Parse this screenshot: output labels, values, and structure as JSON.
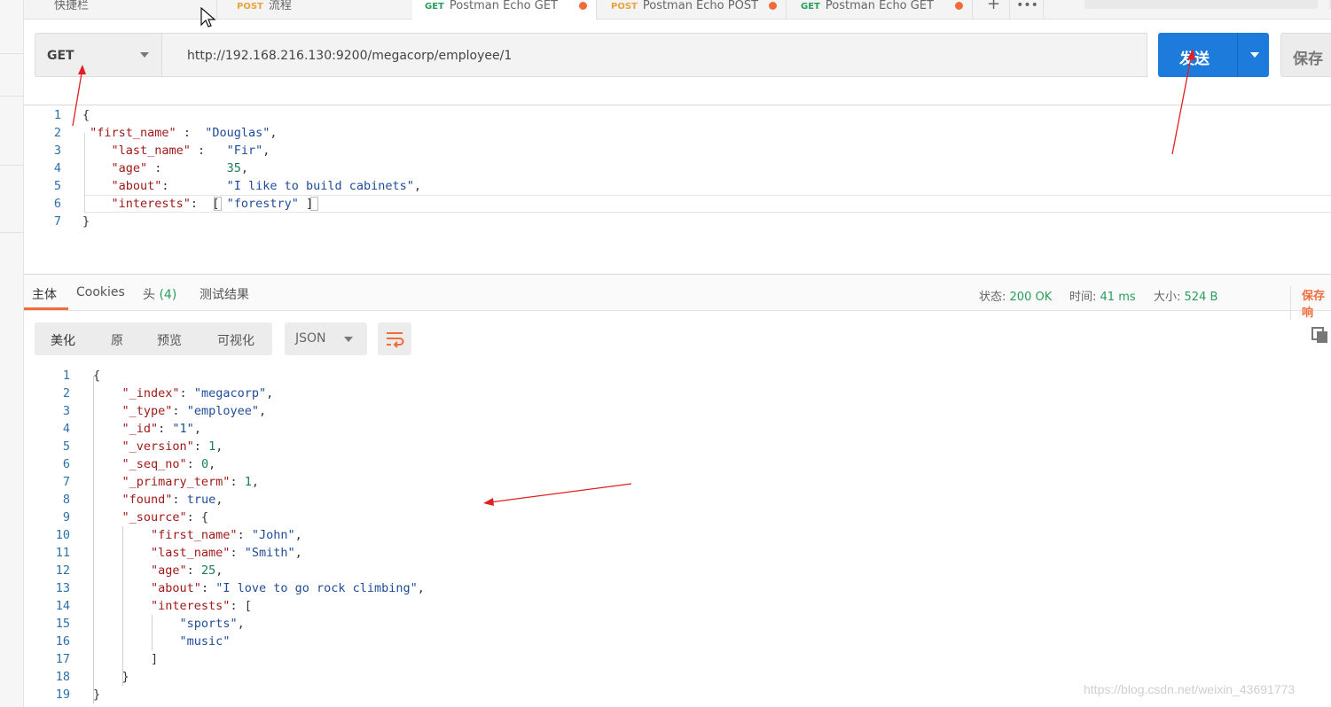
{
  "tabs": [
    {
      "label": "快捷栏",
      "method": "",
      "active": false,
      "dot": false
    },
    {
      "label": "流程",
      "method": "POST",
      "active": false,
      "dot": true
    },
    {
      "label": "Postman Echo GET",
      "method": "GET",
      "active": true,
      "dot": true
    },
    {
      "label": "Postman Echo POST",
      "method": "POST",
      "active": false,
      "dot": true
    },
    {
      "label": "Postman Echo GET",
      "method": "GET",
      "active": false,
      "dot": true
    }
  ],
  "tab_icons": {
    "add": "+",
    "more": "•••"
  },
  "request": {
    "method": "GET",
    "url": "http://192.168.216.130:9200/megacorp/employee/1",
    "send_label": "发送",
    "save_label": "保存"
  },
  "request_body_lines": [
    [
      {
        "t": "{",
        "c": "p"
      }
    ],
    [
      {
        "t": " ",
        "c": "p"
      },
      {
        "t": "\"first_name\"",
        "c": "k"
      },
      {
        "t": " :  ",
        "c": "p"
      },
      {
        "t": "\"Douglas\"",
        "c": "s"
      },
      {
        "t": ",",
        "c": "p"
      }
    ],
    [
      {
        "t": "    ",
        "c": "p"
      },
      {
        "t": "\"last_name\"",
        "c": "k"
      },
      {
        "t": " :   ",
        "c": "p"
      },
      {
        "t": "\"Fir\"",
        "c": "s"
      },
      {
        "t": ",",
        "c": "p"
      }
    ],
    [
      {
        "t": "    ",
        "c": "p"
      },
      {
        "t": "\"age\"",
        "c": "k"
      },
      {
        "t": " :         ",
        "c": "p"
      },
      {
        "t": "35",
        "c": "n"
      },
      {
        "t": ",",
        "c": "p"
      }
    ],
    [
      {
        "t": "    ",
        "c": "p"
      },
      {
        "t": "\"about\"",
        "c": "k"
      },
      {
        "t": ":        ",
        "c": "p"
      },
      {
        "t": "\"I like to build cabinets\"",
        "c": "s"
      },
      {
        "t": ",",
        "c": "p"
      }
    ],
    [
      {
        "t": "    ",
        "c": "p"
      },
      {
        "t": "\"interests\"",
        "c": "k"
      },
      {
        "t": ":  [ ",
        "c": "p"
      },
      {
        "t": "\"forestry\"",
        "c": "s"
      },
      {
        "t": " ]",
        "c": "p"
      }
    ],
    [
      {
        "t": "}",
        "c": "p"
      }
    ]
  ],
  "response_tabs": {
    "body": "主体",
    "cookies": "Cookies",
    "headers": "头",
    "headers_count": "(4)",
    "tests": "测试结果"
  },
  "response_status": {
    "status_label": "状态:",
    "status_value": "200 OK",
    "time_label": "时间:",
    "time_value": "41 ms",
    "size_label": "大小:",
    "size_value": "524 B",
    "save_response": "保存响"
  },
  "view_modes": [
    "美化",
    "原",
    "预览",
    "可视化"
  ],
  "format": "JSON",
  "response_body_lines": [
    [
      {
        "t": "{",
        "c": "p"
      }
    ],
    [
      {
        "t": "    ",
        "c": "p"
      },
      {
        "t": "\"_index\"",
        "c": "k"
      },
      {
        "t": ": ",
        "c": "p"
      },
      {
        "t": "\"megacorp\"",
        "c": "s"
      },
      {
        "t": ",",
        "c": "p"
      }
    ],
    [
      {
        "t": "    ",
        "c": "p"
      },
      {
        "t": "\"_type\"",
        "c": "k"
      },
      {
        "t": ": ",
        "c": "p"
      },
      {
        "t": "\"employee\"",
        "c": "s"
      },
      {
        "t": ",",
        "c": "p"
      }
    ],
    [
      {
        "t": "    ",
        "c": "p"
      },
      {
        "t": "\"_id\"",
        "c": "k"
      },
      {
        "t": ": ",
        "c": "p"
      },
      {
        "t": "\"1\"",
        "c": "s"
      },
      {
        "t": ",",
        "c": "p"
      }
    ],
    [
      {
        "t": "    ",
        "c": "p"
      },
      {
        "t": "\"_version\"",
        "c": "k"
      },
      {
        "t": ": ",
        "c": "p"
      },
      {
        "t": "1",
        "c": "n"
      },
      {
        "t": ",",
        "c": "p"
      }
    ],
    [
      {
        "t": "    ",
        "c": "p"
      },
      {
        "t": "\"_seq_no\"",
        "c": "k"
      },
      {
        "t": ": ",
        "c": "p"
      },
      {
        "t": "0",
        "c": "n"
      },
      {
        "t": ",",
        "c": "p"
      }
    ],
    [
      {
        "t": "    ",
        "c": "p"
      },
      {
        "t": "\"_primary_term\"",
        "c": "k"
      },
      {
        "t": ": ",
        "c": "p"
      },
      {
        "t": "1",
        "c": "n"
      },
      {
        "t": ",",
        "c": "p"
      }
    ],
    [
      {
        "t": "    ",
        "c": "p"
      },
      {
        "t": "\"found\"",
        "c": "k"
      },
      {
        "t": ": ",
        "c": "p"
      },
      {
        "t": "true",
        "c": "s"
      },
      {
        "t": ",",
        "c": "p"
      }
    ],
    [
      {
        "t": "    ",
        "c": "p"
      },
      {
        "t": "\"_source\"",
        "c": "k"
      },
      {
        "t": ": {",
        "c": "p"
      }
    ],
    [
      {
        "t": "        ",
        "c": "p"
      },
      {
        "t": "\"first_name\"",
        "c": "k"
      },
      {
        "t": ": ",
        "c": "p"
      },
      {
        "t": "\"John\"",
        "c": "s"
      },
      {
        "t": ",",
        "c": "p"
      }
    ],
    [
      {
        "t": "        ",
        "c": "p"
      },
      {
        "t": "\"last_name\"",
        "c": "k"
      },
      {
        "t": ": ",
        "c": "p"
      },
      {
        "t": "\"Smith\"",
        "c": "s"
      },
      {
        "t": ",",
        "c": "p"
      }
    ],
    [
      {
        "t": "        ",
        "c": "p"
      },
      {
        "t": "\"age\"",
        "c": "k"
      },
      {
        "t": ": ",
        "c": "p"
      },
      {
        "t": "25",
        "c": "n"
      },
      {
        "t": ",",
        "c": "p"
      }
    ],
    [
      {
        "t": "        ",
        "c": "p"
      },
      {
        "t": "\"about\"",
        "c": "k"
      },
      {
        "t": ": ",
        "c": "p"
      },
      {
        "t": "\"I love to go rock climbing\"",
        "c": "s"
      },
      {
        "t": ",",
        "c": "p"
      }
    ],
    [
      {
        "t": "        ",
        "c": "p"
      },
      {
        "t": "\"interests\"",
        "c": "k"
      },
      {
        "t": ": [",
        "c": "p"
      }
    ],
    [
      {
        "t": "            ",
        "c": "p"
      },
      {
        "t": "\"sports\"",
        "c": "s"
      },
      {
        "t": ",",
        "c": "p"
      }
    ],
    [
      {
        "t": "            ",
        "c": "p"
      },
      {
        "t": "\"music\"",
        "c": "s"
      }
    ],
    [
      {
        "t": "        ]",
        "c": "p"
      }
    ],
    [
      {
        "t": "    }",
        "c": "p"
      }
    ],
    [
      {
        "t": "}",
        "c": "p"
      }
    ]
  ],
  "watermark": "https://blog.csdn.net/weixin_43691773",
  "colors": {
    "accent": "#f26b3a",
    "send": "#1d7bdc",
    "ok": "#2a9d5a"
  }
}
